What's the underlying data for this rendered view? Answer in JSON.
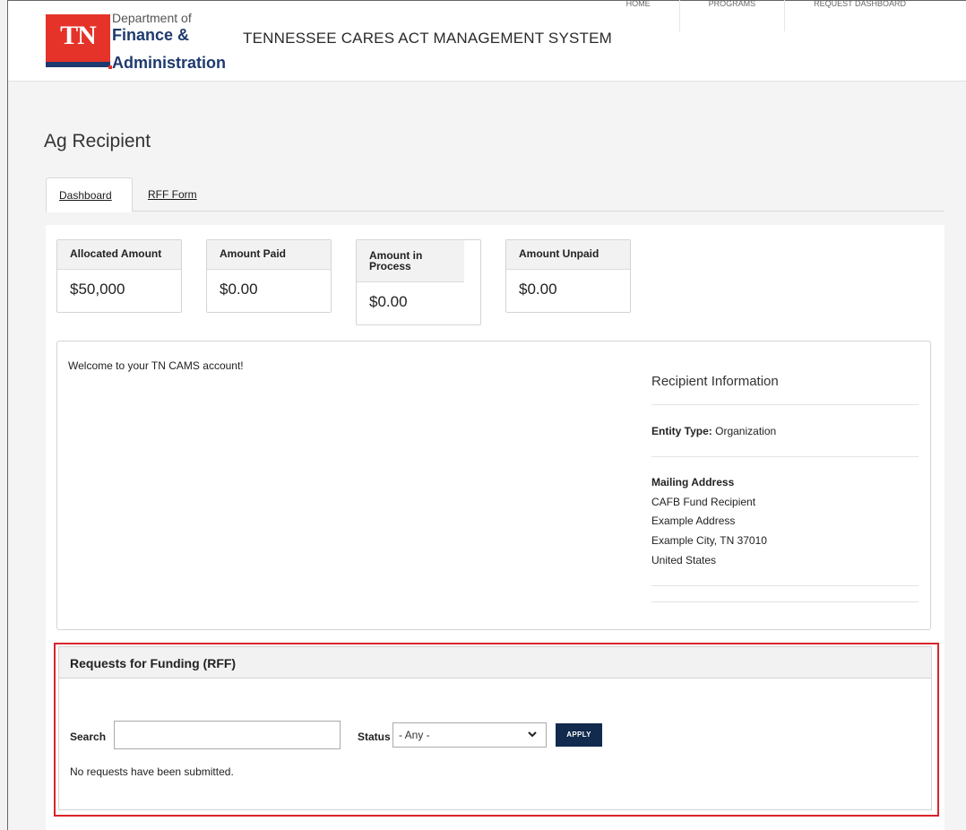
{
  "header": {
    "logo_abbrev": "TN",
    "logo_dept": "Department of",
    "logo_finance": "Finance &",
    "logo_admin": "Administration",
    "site_title": "TENNESSEE CARES ACT MANAGEMENT SYSTEM",
    "nav": [
      "HOME",
      "PROGRAMS",
      "REQUEST DASHBOARD"
    ]
  },
  "page": {
    "title": "Ag Recipient"
  },
  "tabs": [
    {
      "label": "Dashboard",
      "active": true
    },
    {
      "label": "RFF Form",
      "active": false
    }
  ],
  "stats": [
    {
      "label": "Allocated Amount",
      "value": "$50,000"
    },
    {
      "label": "Amount Paid",
      "value": "$0.00"
    },
    {
      "label": "Amount in Process",
      "value": "$0.00"
    },
    {
      "label": "Amount Unpaid",
      "value": "$0.00"
    }
  ],
  "welcome": {
    "text": "Welcome to your TN CAMS account!"
  },
  "recipient": {
    "title": "Recipient Information",
    "entity_label": "Entity Type:",
    "entity_value": "Organization",
    "mailing_label": "Mailing Address",
    "address_lines": [
      "CAFB Fund Recipient",
      "Example Address",
      "Example City, TN 37010",
      "United States"
    ]
  },
  "rff": {
    "title": "Requests for Funding (RFF)",
    "search_label": "Search",
    "search_value": "",
    "status_label": "Status",
    "status_selected": "- Any -",
    "apply_label": "APPLY",
    "empty_text": "No requests have been submitted."
  },
  "colors": {
    "brand_red": "#e5332a",
    "brand_navy": "#1e3a6e",
    "apply_button": "#112a4d",
    "highlight_border": "#d9232b"
  }
}
